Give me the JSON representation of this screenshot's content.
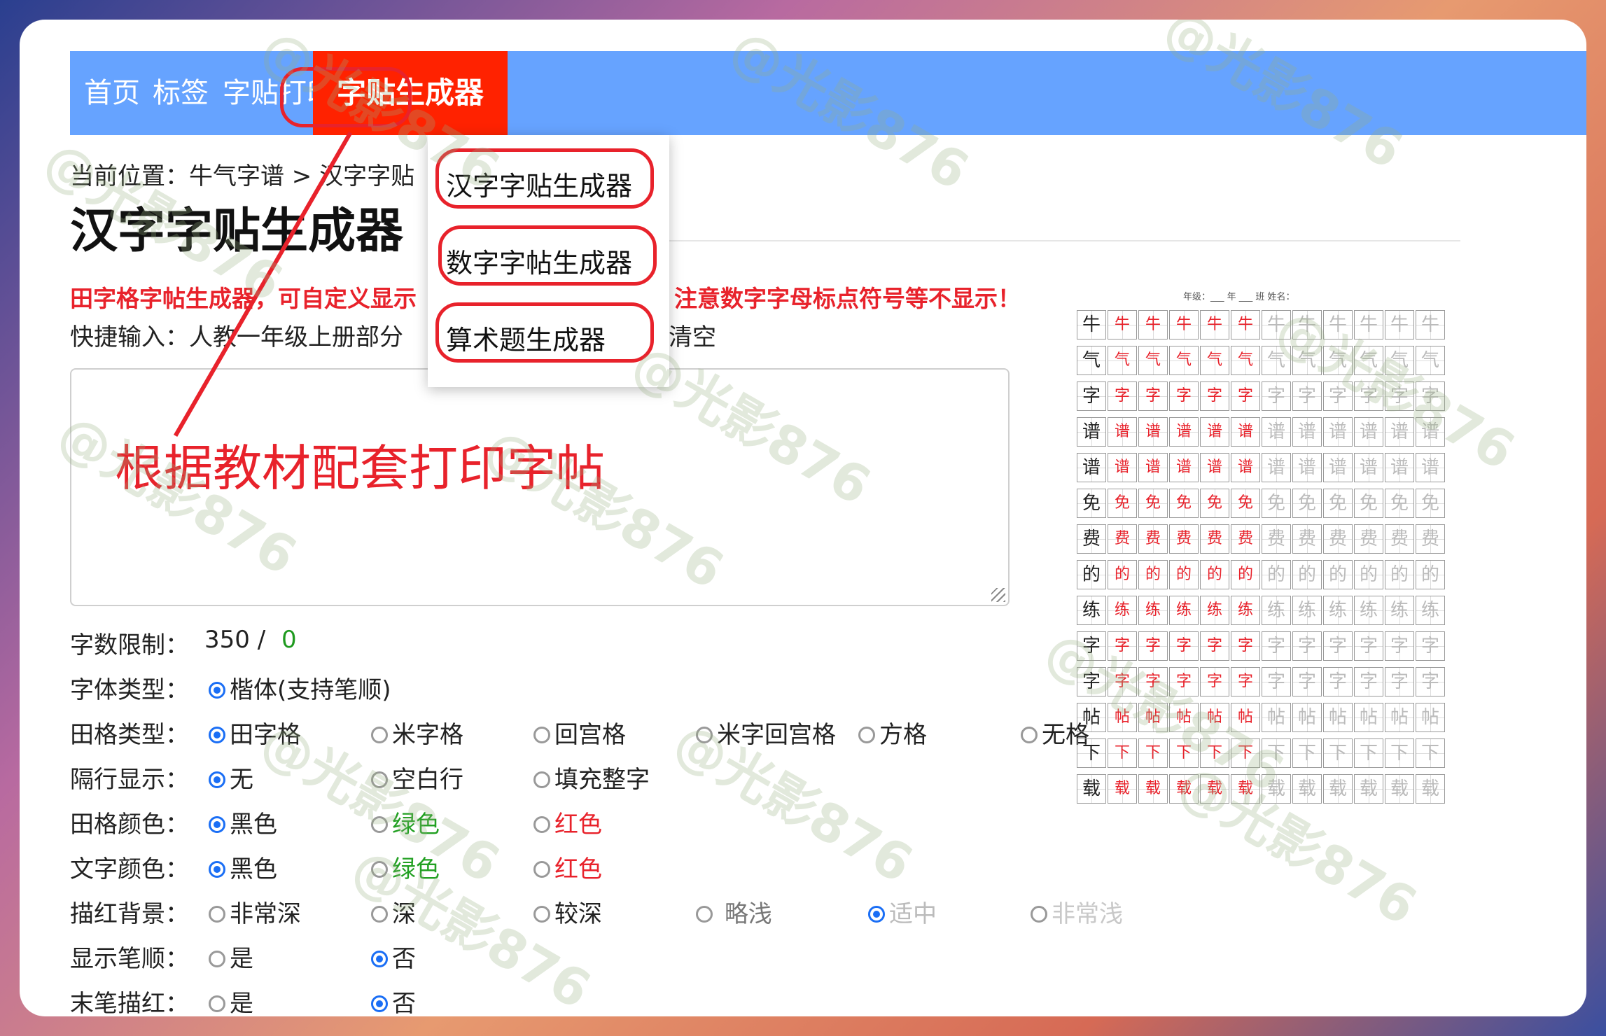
{
  "nav": {
    "items": [
      "首页",
      "标签",
      "字贴打印"
    ],
    "active": "字贴生成器"
  },
  "dropdown": {
    "items": [
      "汉字字贴生成器",
      "数字字帖生成器",
      "算术题生成器"
    ]
  },
  "breadcrumb": "当前位置：牛气字谱 > 汉字字贴",
  "page_title": "汉字字贴生成器",
  "notice": {
    "left": "田字格字帖生成器，可自定义显示",
    "right": "注意数字字母标点符号等不显示！"
  },
  "quick_input": {
    "label": "快捷输入：人教一年级上册部分",
    "clear": "清空"
  },
  "annotation": "根据教材配套打印字帖",
  "word_limit": {
    "label": "字数限制：",
    "max": "350 /",
    "count": "0"
  },
  "settings": {
    "font": {
      "label": "字体类型：",
      "options": [
        "楷体(支持笔顺)"
      ]
    },
    "grid": {
      "label": "田格类型：",
      "options": [
        "田字格",
        "米字格",
        "回宫格",
        "米字回宫格",
        "方格",
        "无格"
      ]
    },
    "spacing": {
      "label": "隔行显示：",
      "options": [
        "无",
        "空白行",
        "填充整字"
      ]
    },
    "grid_color": {
      "label": "田格颜色：",
      "options": [
        "黑色",
        "绿色",
        "红色"
      ]
    },
    "text_color": {
      "label": "文字颜色：",
      "options": [
        "黑色",
        "绿色",
        "红色"
      ]
    },
    "trace_bg": {
      "label": "描红背景：",
      "options": [
        "非常深",
        "深",
        "较深",
        "略浅",
        "适中",
        "非常浅"
      ]
    },
    "stroke_order": {
      "label": "显示笔顺：",
      "options": [
        "是",
        "否"
      ]
    },
    "last_stroke": {
      "label": "末笔描红：",
      "options": [
        "是",
        "否"
      ]
    }
  },
  "preview": {
    "header": "年级：___ 年 ___ 班   姓名：",
    "chars": [
      "牛",
      "气",
      "字",
      "谱",
      "谱",
      "免",
      "费",
      "的",
      "练",
      "字",
      "字",
      "帖",
      "下",
      "载"
    ]
  },
  "watermark": "@光影876"
}
